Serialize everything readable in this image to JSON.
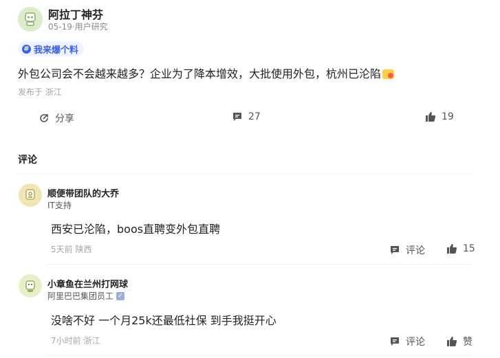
{
  "post": {
    "author": "阿拉丁神芬",
    "meta": "05-19·用户研究",
    "tag": "我来爆个料",
    "text": "外包公司会不会越来越多？企业为了降本增效，大批使用外包，杭州已沦陷",
    "location": "发布于 浙江",
    "actions": {
      "share_label": "分享",
      "comment_count": "27",
      "like_count": "19"
    }
  },
  "comments_section": {
    "title": "评论",
    "items": [
      {
        "author": "顺便带团队的大乔",
        "subtitle": "IT支持",
        "text": "西安已沦陷，boos直聘变外包直聘",
        "meta": "5天前 陕西",
        "comment_label": "评论",
        "like_label": "15"
      },
      {
        "author": "小章鱼在兰州打网球",
        "subtitle": "阿里巴巴集团员工",
        "text": "没啥不好 一个月25k还最低社保 到手我挺开心",
        "meta": "7小时前 浙江",
        "comment_label": "评论",
        "like_label": "赞"
      }
    ]
  },
  "icons": [
    "avatar-icon",
    "hashtag-icon",
    "share-icon",
    "comment-icon",
    "thumbs-up-icon",
    "verified-badge-icon",
    "emoji-icon"
  ],
  "colors": {
    "accent": "#3b62e6",
    "text": "#1f1f1f",
    "muted": "#8a8a8a"
  }
}
